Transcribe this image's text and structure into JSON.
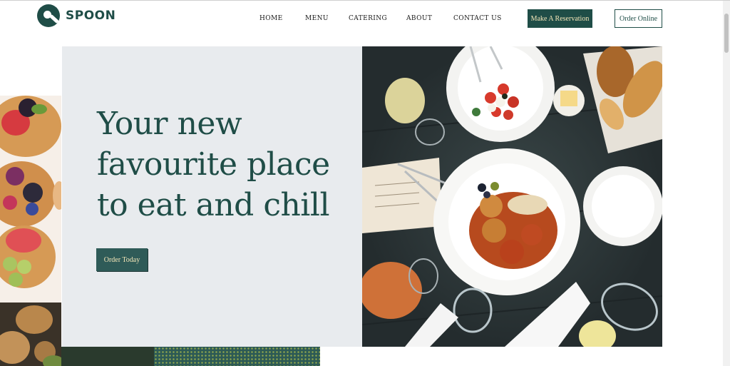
{
  "brand": {
    "name": "SPOON"
  },
  "nav": {
    "items": [
      {
        "label": "HOME"
      },
      {
        "label": "MENU"
      },
      {
        "label": "CATERING"
      },
      {
        "label": "ABOUT"
      },
      {
        "label": "CONTACT US"
      }
    ]
  },
  "header": {
    "reserve_label": "Make A Reservation",
    "order_label": "Order Online"
  },
  "hero": {
    "title_line1": "Your new",
    "title_line2": "favourite place",
    "title_line3": "to eat and chill",
    "cta_label": "Order Today"
  },
  "colors": {
    "brand": "#1f4d47",
    "button_text": "#f4e6b8",
    "hero_bg": "#e8ebee"
  },
  "icons": [
    "spoon-logo-icon"
  ]
}
